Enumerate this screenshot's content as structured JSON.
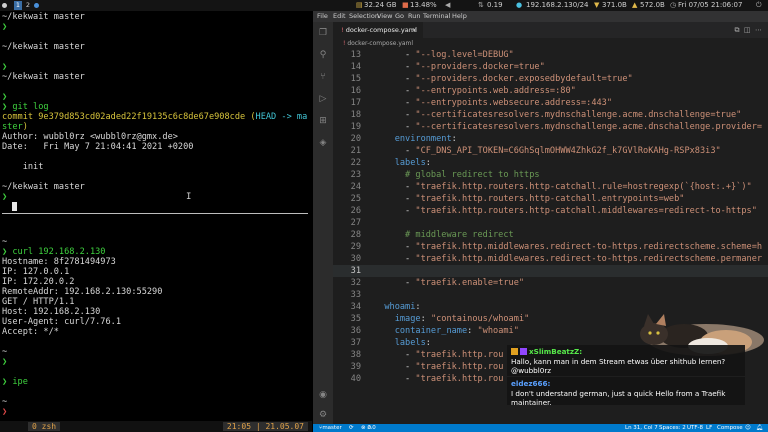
{
  "topbar": {
    "workspaces": [
      "1",
      "2"
    ],
    "disk": "32.24 GB",
    "cpu": "13.48%",
    "network_rate": "0.19",
    "ip_address": "192.168.2.130/24",
    "download": "371.0B",
    "upload": "572.0B",
    "clock": "Fri 07/05 21:06:07"
  },
  "terminal": {
    "lines": [
      {
        "segments": [
          {
            "t": "~/kekwait ",
            "c": "d"
          },
          {
            "t": "master",
            "c": "d"
          }
        ]
      },
      {
        "segments": [
          {
            "t": "❯",
            "c": "d"
          }
        ]
      },
      {
        "segments": []
      },
      {
        "segments": [
          {
            "t": "~/kekwait ",
            "c": "d"
          },
          {
            "t": "master",
            "c": "d"
          }
        ]
      },
      {
        "segments": []
      },
      {
        "segments": [
          {
            "t": "❯",
            "c": "d"
          }
        ]
      },
      {
        "segments": [
          {
            "t": "~/kekwait ",
            "c": "d"
          },
          {
            "t": "master",
            "c": "d"
          }
        ]
      },
      {
        "segments": []
      },
      {
        "segments": [
          {
            "t": "❯",
            "c": "d"
          }
        ]
      },
      {
        "segments": [
          {
            "t": "❯ git log",
            "c": "d"
          }
        ]
      },
      {
        "segments": [
          {
            "t": "commit 9e379d853cd02aded22f19135c6c8de67e908cde (",
            "c": "yellow"
          },
          {
            "t": "HEAD -> ma",
            "c": "cyan"
          }
        ]
      },
      {
        "segments": [
          {
            "t": "ster",
            "c": "green"
          },
          {
            "t": ")",
            "c": "yellow"
          }
        ]
      },
      {
        "segments": [
          {
            "t": "Author: wubbl0rz <wubbl0rz@gmx.de>",
            "c": "d"
          }
        ]
      },
      {
        "segments": [
          {
            "t": "Date:   Fri May 7 21:04:41 2021 +0200",
            "c": "d"
          }
        ]
      },
      {
        "segments": []
      },
      {
        "segments": [
          {
            "t": "    init",
            "c": "d"
          }
        ]
      },
      {
        "segments": []
      },
      {
        "segments": [
          {
            "t": "~/kekwait ",
            "c": "d"
          },
          {
            "t": "master",
            "c": "d"
          }
        ]
      },
      {
        "segments": [
          {
            "t": "❯ ",
            "c": "d"
          }
        ]
      }
    ],
    "lines2": [
      {
        "segments": [
          {
            "t": "~",
            "c": "d"
          }
        ]
      },
      {
        "segments": [
          {
            "t": "❯ curl 192.168.2.130",
            "c": "d"
          }
        ]
      },
      {
        "segments": [
          {
            "t": "Hostname: 8f2781494973",
            "c": "d"
          }
        ]
      },
      {
        "segments": [
          {
            "t": "IP: 127.0.0.1",
            "c": "d"
          }
        ]
      },
      {
        "segments": [
          {
            "t": "IP: 172.20.0.2",
            "c": "d"
          }
        ]
      },
      {
        "segments": [
          {
            "t": "RemoteAddr: 192.168.2.130:55290",
            "c": "d"
          }
        ]
      },
      {
        "segments": [
          {
            "t": "GET / HTTP/1.1",
            "c": "d"
          }
        ]
      },
      {
        "segments": [
          {
            "t": "Host: 192.168.2.130",
            "c": "d"
          }
        ]
      },
      {
        "segments": [
          {
            "t": "User-Agent: curl/7.76.1",
            "c": "d"
          }
        ]
      },
      {
        "segments": [
          {
            "t": "Accept: */*",
            "c": "d"
          }
        ]
      }
    ],
    "lines3": [
      {
        "segments": [
          {
            "t": "~",
            "c": "d"
          }
        ]
      },
      {
        "segments": [
          {
            "t": "❯",
            "c": "d"
          }
        ]
      },
      {
        "segments": []
      },
      {
        "segments": [
          {
            "t": "❯ ipe",
            "c": "d"
          }
        ]
      },
      {
        "segments": []
      },
      {
        "segments": [
          {
            "t": "~",
            "c": "d"
          }
        ]
      },
      {
        "segments": [
          {
            "t": "❯",
            "c": "red"
          }
        ]
      }
    ],
    "tmux": {
      "window_index": "0",
      "window_name": "zsh",
      "time": "21:05",
      "date": "21.05.07"
    }
  },
  "vscode": {
    "menu": [
      "File",
      "Edit",
      "Selection",
      "View",
      "Go",
      "Run",
      "Terminal",
      "Help"
    ],
    "tab_label": "docker-compose.yaml",
    "breadcrumb": "docker-compose.yaml",
    "current_line": "31",
    "code": [
      {
        "n": "13",
        "segs": [
          {
            "t": "      - ",
            "c": "d"
          },
          {
            "t": "\"--log.level=DEBUG\"",
            "c": "s"
          }
        ]
      },
      {
        "n": "14",
        "segs": [
          {
            "t": "      - ",
            "c": "d"
          },
          {
            "t": "\"--providers.docker=true\"",
            "c": "s"
          }
        ]
      },
      {
        "n": "15",
        "segs": [
          {
            "t": "      - ",
            "c": "d"
          },
          {
            "t": "\"--providers.docker.exposedbydefault=true\"",
            "c": "s"
          }
        ]
      },
      {
        "n": "16",
        "segs": [
          {
            "t": "      - ",
            "c": "d"
          },
          {
            "t": "\"--entrypoints.web.address=:80\"",
            "c": "s"
          }
        ]
      },
      {
        "n": "17",
        "segs": [
          {
            "t": "      - ",
            "c": "d"
          },
          {
            "t": "\"--entrypoints.websecure.address=:443\"",
            "c": "s"
          }
        ]
      },
      {
        "n": "18",
        "segs": [
          {
            "t": "      - ",
            "c": "d"
          },
          {
            "t": "\"--certificatesresolvers.mydnschallenge.acme.dnschallenge=true\"",
            "c": "s"
          }
        ]
      },
      {
        "n": "19",
        "segs": [
          {
            "t": "      - ",
            "c": "d"
          },
          {
            "t": "\"--certificatesresolvers.mydnschallenge.acme.dnschallenge.provider=",
            "c": "s"
          }
        ]
      },
      {
        "n": "20",
        "segs": [
          {
            "t": "    ",
            "c": "d"
          },
          {
            "t": "environment",
            "c": "k"
          },
          {
            "t": ":",
            "c": "d"
          }
        ]
      },
      {
        "n": "21",
        "segs": [
          {
            "t": "      - ",
            "c": "d"
          },
          {
            "t": "\"CF_DNS_API_TOKEN=C6GhSqlmOHWW4ZhkG2f_k7GVlRoKAHg-RSPx83i3\"",
            "c": "s"
          }
        ]
      },
      {
        "n": "22",
        "segs": [
          {
            "t": "    ",
            "c": "d"
          },
          {
            "t": "labels",
            "c": "k"
          },
          {
            "t": ":",
            "c": "d"
          }
        ]
      },
      {
        "n": "23",
        "segs": [
          {
            "t": "      ",
            "c": "d"
          },
          {
            "t": "# global redirect to https",
            "c": "c"
          }
        ]
      },
      {
        "n": "24",
        "segs": [
          {
            "t": "      - ",
            "c": "d"
          },
          {
            "t": "\"traefik.http.routers.http-catchall.rule=hostregexp(`{host:.+}`)\"",
            "c": "s"
          }
        ]
      },
      {
        "n": "25",
        "segs": [
          {
            "t": "      - ",
            "c": "d"
          },
          {
            "t": "\"traefik.http.routers.http-catchall.entrypoints=web\"",
            "c": "s"
          }
        ]
      },
      {
        "n": "26",
        "segs": [
          {
            "t": "      - ",
            "c": "d"
          },
          {
            "t": "\"traefik.http.routers.http-catchall.middlewares=redirect-to-https\"",
            "c": "s"
          }
        ]
      },
      {
        "n": "27",
        "segs": []
      },
      {
        "n": "28",
        "segs": [
          {
            "t": "      ",
            "c": "d"
          },
          {
            "t": "# middleware redirect",
            "c": "c"
          }
        ]
      },
      {
        "n": "29",
        "segs": [
          {
            "t": "      - ",
            "c": "d"
          },
          {
            "t": "\"traefik.http.middlewares.redirect-to-https.redirectscheme.scheme=h",
            "c": "s"
          }
        ]
      },
      {
        "n": "30",
        "segs": [
          {
            "t": "      - ",
            "c": "d"
          },
          {
            "t": "\"traefik.http.middlewares.redirect-to-https.redirectscheme.permaner",
            "c": "s"
          }
        ]
      },
      {
        "n": "31",
        "segs": []
      },
      {
        "n": "32",
        "segs": [
          {
            "t": "      - ",
            "c": "d"
          },
          {
            "t": "\"traefik.enable=true\"",
            "c": "s"
          }
        ]
      },
      {
        "n": "33",
        "segs": []
      },
      {
        "n": "34",
        "segs": [
          {
            "t": "  ",
            "c": "d"
          },
          {
            "t": "whoami",
            "c": "k"
          },
          {
            "t": ":",
            "c": "d"
          }
        ]
      },
      {
        "n": "35",
        "segs": [
          {
            "t": "    ",
            "c": "d"
          },
          {
            "t": "image",
            "c": "k"
          },
          {
            "t": ": ",
            "c": "d"
          },
          {
            "t": "\"containous/whoami\"",
            "c": "s"
          }
        ]
      },
      {
        "n": "36",
        "segs": [
          {
            "t": "    ",
            "c": "d"
          },
          {
            "t": "container_name",
            "c": "k"
          },
          {
            "t": ": ",
            "c": "d"
          },
          {
            "t": "\"whoami\"",
            "c": "s"
          }
        ]
      },
      {
        "n": "37",
        "segs": [
          {
            "t": "    ",
            "c": "d"
          },
          {
            "t": "labels",
            "c": "k"
          },
          {
            "t": ":",
            "c": "d"
          }
        ]
      },
      {
        "n": "38",
        "segs": [
          {
            "t": "      - ",
            "c": "d"
          },
          {
            "t": "\"traefik.http.rou",
            "c": "s"
          }
        ]
      },
      {
        "n": "39",
        "segs": [
          {
            "t": "      - ",
            "c": "d"
          },
          {
            "t": "\"traefik.http.rou",
            "c": "s"
          }
        ]
      },
      {
        "n": "40",
        "segs": [
          {
            "t": "      - ",
            "c": "d"
          },
          {
            "t": "\"traefik.http.rou",
            "c": "s"
          }
        ]
      }
    ],
    "status": {
      "branch": "master",
      "errors": "0",
      "warnings": "0",
      "position": "Ln 31, Col 7",
      "spaces": "Spaces: 2",
      "encoding": "UTF-8",
      "eol": "LF",
      "language": "Compose"
    }
  },
  "chat": {
    "messages": [
      {
        "user": "xSlimBeatzZ:",
        "text": "Hallo, kann man in dem Stream etwas über shithub lernen? @wubbl0rz"
      },
      {
        "user": "eldez666:",
        "text": "I don't understand german, just a quick Hello from a Traefik maintainer."
      }
    ]
  },
  "colors": {
    "terminal_bg": "#000000",
    "editor_bg": "#1e1e1e",
    "statusbar": "#007acc",
    "string": "#ce9178",
    "keyword": "#569cd6",
    "comment": "#6a9955",
    "prompt_green": "#3fd23f"
  }
}
